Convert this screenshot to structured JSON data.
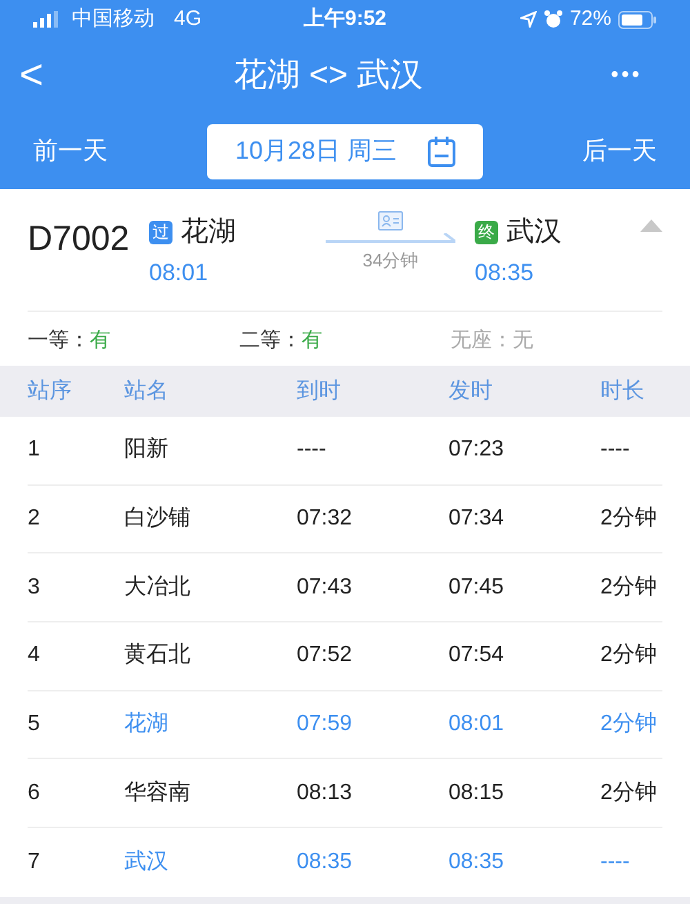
{
  "status_bar": {
    "carrier": "中国移动",
    "network": "4G",
    "time": "上午9:52",
    "battery": "72%"
  },
  "nav": {
    "back": "<",
    "title": "花湖 <> 武汉",
    "more": "•••"
  },
  "date_bar": {
    "prev": "前一天",
    "date": "10月28日 周三",
    "next": "后一天"
  },
  "train": {
    "number": "D7002",
    "expanded": true,
    "from": {
      "badge": "过",
      "kind": "pass",
      "station": "花湖",
      "time": "08:01"
    },
    "duration": "34分钟",
    "to": {
      "badge": "终",
      "kind": "terminal",
      "station": "武汉",
      "time": "08:35"
    },
    "seats": [
      {
        "label": "一等：",
        "value": "有",
        "available": true
      },
      {
        "label": "二等：",
        "value": "有",
        "available": true
      },
      {
        "label": "无座：",
        "value": "无",
        "available": false
      }
    ]
  },
  "table": {
    "columns": [
      "站序",
      "站名",
      "到时",
      "发时",
      "时长"
    ],
    "rows": [
      {
        "cells": [
          "1",
          "阳新",
          "----",
          "07:23",
          "----"
        ],
        "highlighted": false
      },
      {
        "cells": [
          "2",
          "白沙铺",
          "07:32",
          "07:34",
          "2分钟"
        ],
        "highlighted": false
      },
      {
        "cells": [
          "3",
          "大冶北",
          "07:43",
          "07:45",
          "2分钟"
        ],
        "highlighted": false
      },
      {
        "cells": [
          "4",
          "黄石北",
          "07:52",
          "07:54",
          "2分钟"
        ],
        "highlighted": false
      },
      {
        "cells": [
          "5",
          "花湖",
          "07:59",
          "08:01",
          "2分钟"
        ],
        "highlighted": true
      },
      {
        "cells": [
          "6",
          "华容南",
          "08:13",
          "08:15",
          "2分钟"
        ],
        "highlighted": false
      },
      {
        "cells": [
          "7",
          "武汉",
          "08:35",
          "08:35",
          "----"
        ],
        "highlighted": true
      }
    ]
  }
}
